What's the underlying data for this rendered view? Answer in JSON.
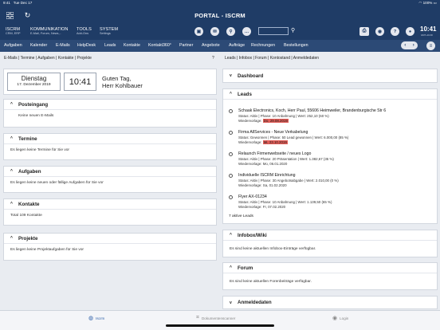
{
  "status": {
    "time": "9:41",
    "date": "Tue Dec 17",
    "battery": "100%"
  },
  "app": {
    "title": "PORTAL - ISCRM"
  },
  "nav": [
    {
      "title": "ISCRM",
      "sub": "CRM, ERP"
    },
    {
      "title": "KOMMUNIKATION",
      "sub": "E-Mail, Forum, News,.."
    },
    {
      "title": "TOOLS",
      "sub": "Add-Ons"
    },
    {
      "title": "SYSTEM",
      "sub": "Settings"
    }
  ],
  "header_clock": {
    "time": "10:41",
    "sub": "GMT+01:00"
  },
  "tabs": [
    "Aufgaben",
    "Kalender",
    "E-Mails",
    "HelpDesk",
    "Leads",
    "Kontakte",
    "Kontakt360°",
    "Partner",
    "Angebote",
    "Aufträge",
    "Rechnungen",
    "Bestellungen"
  ],
  "crumbs": {
    "left": "E-Mails | Termine | Aufgaben | Kontakte | Projekte",
    "help": "?",
    "right": "Leads | Infobox | Forum | Kontostand | Anmeldedaten"
  },
  "today": {
    "day": "Dienstag",
    "date": "17. Dezember 2019",
    "time": "10:41",
    "greeting1": "Guten Tag,",
    "greeting2": "Herr Kohlbauer"
  },
  "left_panels": {
    "posteingang": {
      "title": "Posteingang",
      "text": "Keine neuen E-Mails"
    },
    "termine": {
      "title": "Termine",
      "text": "Es liegen keine Termine für Sie vor"
    },
    "aufgaben": {
      "title": "Aufgaben",
      "text": "Es liegen keine neuen oder fällige Aufgaben für Sie vor"
    },
    "kontakte": {
      "title": "Kontakte",
      "text": "Total 109 Kontakte"
    },
    "projekte": {
      "title": "Projekte",
      "text": "Es liegen keine Projektaufgaben für Sie vor"
    }
  },
  "dashboard": {
    "title": "Dashboard"
  },
  "leads": {
    "title": "Leads",
    "items": [
      {
        "name": "Schaak Electronics, Koch, Herr Paul, 55606 Heimweiler, Brandenburgische Str 6",
        "status": "Status: Aktiv | Phase: 10 Anbahnung | Wert: 252,10 (60 %)",
        "wv_label": "Wiedervorlage:",
        "wv_date": "Do, 29.08.2019",
        "overdue": true
      },
      {
        "name": "Firma AllServices - Neue Verkabelung",
        "status": "Status: Gewonnen | Phase: 50 Lead gewonnen | Wert: 6.000,00 (85 %)",
        "wv_label": "Wiedervorlage:",
        "wv_date": "Mi, 23.10.2019",
        "overdue": true
      },
      {
        "name": "Relaunch Firmenwebseite / neues Logo",
        "status": "Status: Aktiv | Phase: 20 Präsentation | Wert: 1.382,67 (35 %)",
        "wv_label": "Wiedervorlage:",
        "wv_date": "Mo, 06.01.2020",
        "overdue": false
      },
      {
        "name": "Individuelle ISCRM Einrichtung",
        "status": "Status: Aktiv | Phase: 30 Angebotsabgabe | Wert: 2.010,00 (0 %)",
        "wv_label": "Wiedervorlage:",
        "wv_date": "Sa, 01.02.2020",
        "overdue": false
      },
      {
        "name": "Flyer AX-01234",
        "status": "Status: Aktiv | Phase: 10 Anbahnung | Wert: 1.139,50 (65 %)",
        "wv_label": "Wiedervorlage:",
        "wv_date": "Fr, 07.02.2020",
        "overdue": false
      }
    ],
    "count": "7 aktive Leads"
  },
  "infobox": {
    "title": "Infobox/Wiki",
    "text": "Es sind keine aktuellen Infobox-Einträge verfügbar."
  },
  "forum": {
    "title": "Forum",
    "text": "Es sind keine aktuellen Forenbeiträge verfügbar."
  },
  "anmeldedaten": {
    "title": "Anmeldedaten"
  },
  "bottom_tabs": [
    {
      "label": "Iscrm",
      "icon": "globe-icon",
      "active": true
    },
    {
      "label": "Dokumentenscanner",
      "icon": "scanner-icon",
      "active": false
    },
    {
      "label": "Login",
      "icon": "user-icon",
      "active": false
    }
  ],
  "colors": {
    "header": "#1f3c66",
    "tabbar": "#2c4a76",
    "overdue": "#e4605a",
    "active_tab": "#2d5fa8"
  }
}
